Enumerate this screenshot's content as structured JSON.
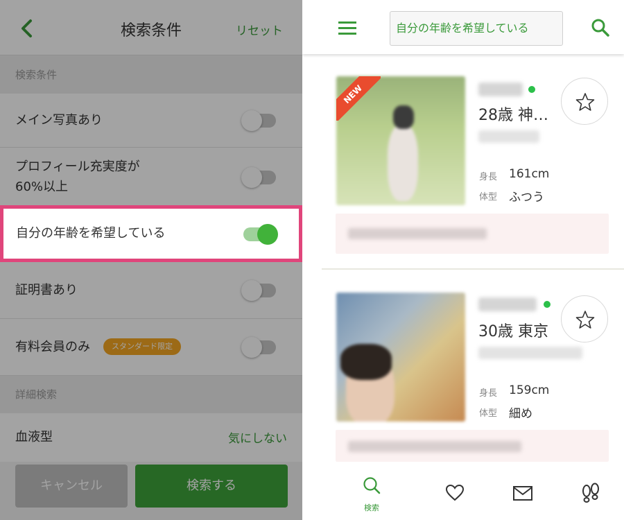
{
  "left_panel": {
    "header": {
      "title": "検索条件",
      "reset_label": "リセット"
    },
    "section1_title": "検索条件",
    "items": {
      "main_photo": {
        "label": "メイン写真あり",
        "on": false
      },
      "profile_fill": {
        "label_line1": "プロフィール充実度が",
        "label_line2": "60%以上",
        "on": false
      },
      "wants_my_age": {
        "label": "自分の年齢を希望している",
        "on": true
      },
      "certificate": {
        "label": "証明書あり",
        "on": false
      },
      "paid_only": {
        "label": "有料会員のみ",
        "badge": "スタンダード限定",
        "on": false
      }
    },
    "section2_title": "詳細検索",
    "blood_type": {
      "label": "血液型",
      "value": "気にしない"
    },
    "buttons": {
      "cancel": "キャンセル",
      "search": "検索する"
    }
  },
  "right_panel": {
    "search_text": "自分の年齢を希望している",
    "cards": [
      {
        "new_badge": "NEW",
        "age_location": "28歳 神…",
        "height_label": "身長",
        "height": "161cm",
        "body_label": "体型",
        "body": "ふつう"
      },
      {
        "age_location": "30歳 東京",
        "height_label": "身長",
        "height": "159cm",
        "body_label": "体型",
        "body": "細め"
      }
    ],
    "tabbar": {
      "search_label": "検索"
    }
  },
  "colors": {
    "accent_green": "#3a9a3a",
    "highlight_pink": "#e0457b",
    "online_green": "#2cc04a",
    "new_red": "#e94c2e",
    "badge_orange": "#f5a623"
  },
  "icons": [
    "back-arrow-icon",
    "menu-icon",
    "search-icon",
    "star-icon",
    "heart-icon",
    "mail-icon",
    "footprints-icon"
  ]
}
